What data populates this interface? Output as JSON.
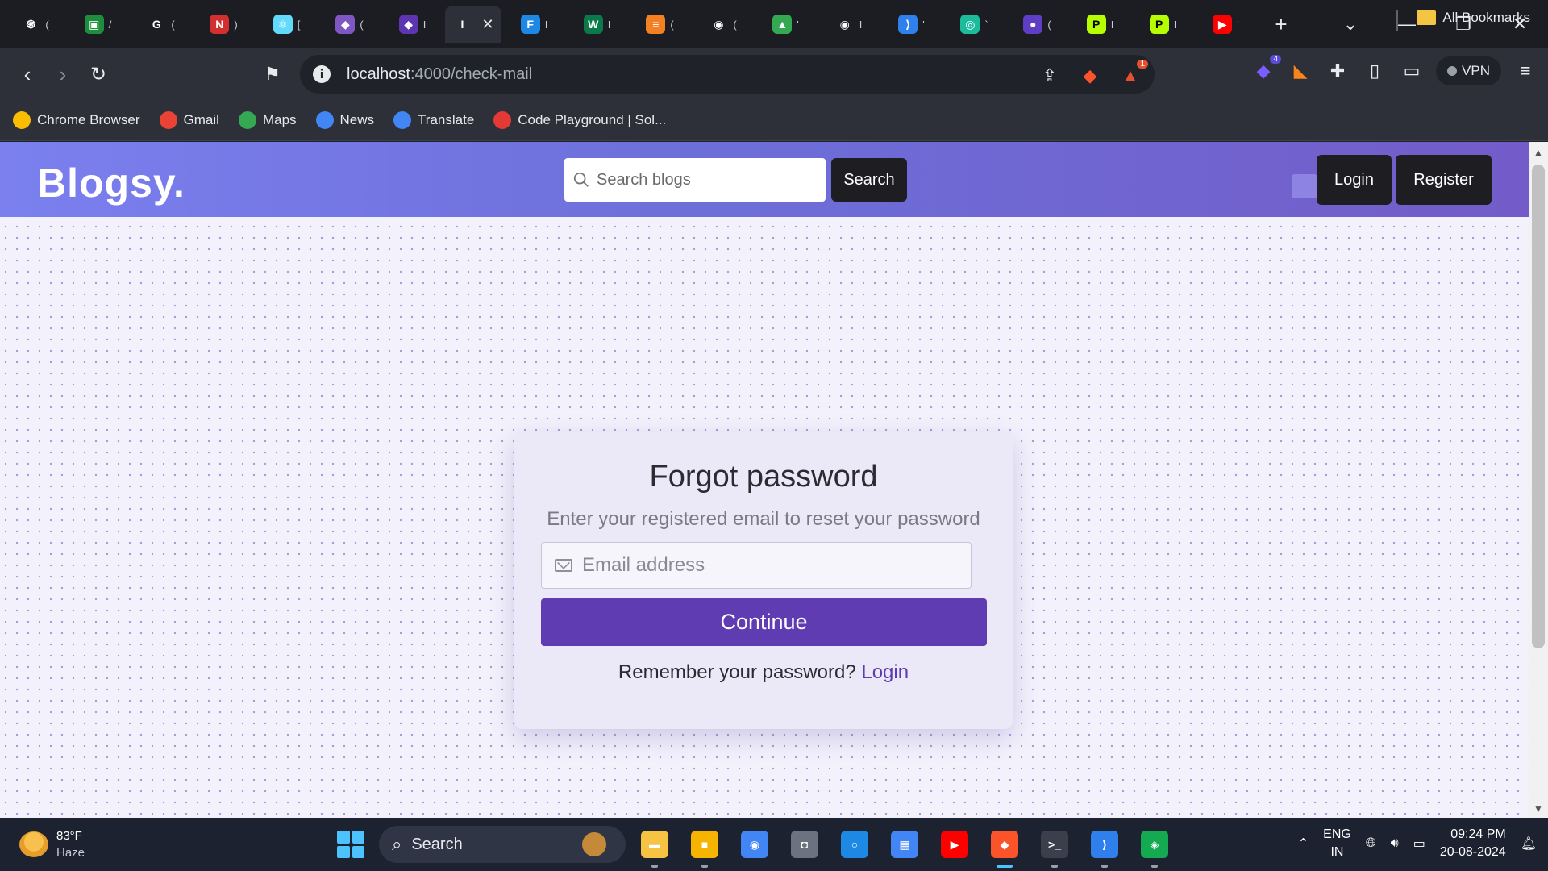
{
  "browser": {
    "tabs": [
      {
        "icon": "chatgpt-icon",
        "color": "#ffffff",
        "glyph": "֍",
        "title": "("
      },
      {
        "icon": "classroom-icon",
        "color": "#1e8e3e",
        "glyph": "▣",
        "title": "/"
      },
      {
        "icon": "google-icon",
        "color": "#ffffff",
        "glyph": "G",
        "title": "("
      },
      {
        "icon": "n-icon",
        "color": "#d32f2f",
        "glyph": "N",
        "title": ")"
      },
      {
        "icon": "react-icon",
        "color": "#61dafb",
        "glyph": "⚛",
        "title": "["
      },
      {
        "icon": "shield-icon",
        "color": "#7e57c2",
        "glyph": "◆",
        "title": "("
      },
      {
        "icon": "diamond-icon",
        "color": "#5e35b1",
        "glyph": "◆",
        "title": "I"
      },
      {
        "icon": "blank-icon",
        "color": "#2d3038",
        "glyph": "I",
        "title": ""
      },
      {
        "icon": "f-icon",
        "color": "#1e88e5",
        "glyph": "F",
        "title": "I"
      },
      {
        "icon": "w-icon",
        "color": "#0b7a4b",
        "glyph": "W",
        "title": "I"
      },
      {
        "icon": "stackoverflow-icon",
        "color": "#f48024",
        "glyph": "≡",
        "title": "("
      },
      {
        "icon": "github-icon",
        "color": "#ffffff",
        "glyph": "◉",
        "title": "("
      },
      {
        "icon": "drive-icon",
        "color": "#34a853",
        "glyph": "▲",
        "title": "'"
      },
      {
        "icon": "github-icon",
        "color": "#ffffff",
        "glyph": "◉",
        "title": "I"
      },
      {
        "icon": "vscode-icon",
        "color": "#2f80ed",
        "glyph": "⟩",
        "title": "'"
      },
      {
        "icon": "globe-icon",
        "color": "#1abc9c",
        "glyph": "◎",
        "title": "`"
      },
      {
        "icon": "meet-icon",
        "color": "#5f3dc4",
        "glyph": "●",
        "title": "("
      },
      {
        "icon": "p-icon",
        "color": "#b6ff00",
        "glyph": "P",
        "title": "I"
      },
      {
        "icon": "p-icon",
        "color": "#b6ff00",
        "glyph": "P",
        "title": "I"
      },
      {
        "icon": "youtube-icon",
        "color": "#ff0000",
        "glyph": "▶",
        "title": "'"
      }
    ],
    "active_tab_index": 7,
    "url_host": "localhost",
    "url_path": ":4000/check-mail",
    "bookmarks": [
      {
        "label": "Chrome Browser",
        "icon": "chrome-icon",
        "color": "#fbbc04"
      },
      {
        "label": "Gmail",
        "icon": "gmail-icon",
        "color": "#ea4335"
      },
      {
        "label": "Maps",
        "icon": "maps-icon",
        "color": "#34a853"
      },
      {
        "label": "News",
        "icon": "news-icon",
        "color": "#4285f4"
      },
      {
        "label": "Translate",
        "icon": "translate-icon",
        "color": "#4285f4"
      },
      {
        "label": "Code Playground | Sol...",
        "icon": "sololearn-icon",
        "color": "#e53935"
      }
    ],
    "all_bookmarks_label": "All Bookmarks",
    "vpn_label": "VPN",
    "ext_badge_count": "4",
    "brave_rewards_badge": "1"
  },
  "site": {
    "brand": "Blogsy.",
    "search_placeholder": "Search blogs",
    "search_button": "Search",
    "login_button": "Login",
    "register_button": "Register"
  },
  "card": {
    "title": "Forgot password",
    "subtitle": "Enter your registered email to reset your password",
    "email_placeholder": "Email address",
    "continue_button": "Continue",
    "remember_text": "Remember your password?",
    "login_link": "Login"
  },
  "taskbar": {
    "temperature": "83°F",
    "weather": "Haze",
    "search_label": "Search",
    "lang_top": "ENG",
    "lang_bottom": "IN",
    "time": "09:24 PM",
    "date": "20-08-2024",
    "apps": [
      {
        "icon": "file-explorer-icon",
        "color": "#f6c343",
        "glyph": "▬",
        "state": "running"
      },
      {
        "icon": "folder-icon",
        "color": "#f4b400",
        "glyph": "■",
        "state": "running"
      },
      {
        "icon": "chrome-icon",
        "color": "#4285f4",
        "glyph": "◉",
        "state": ""
      },
      {
        "icon": "camera-icon",
        "color": "#6b7280",
        "glyph": "◘",
        "state": ""
      },
      {
        "icon": "cortana-icon",
        "color": "#1e88e5",
        "glyph": "○",
        "state": ""
      },
      {
        "icon": "store-icon",
        "color": "#4285f4",
        "glyph": "▦",
        "state": ""
      },
      {
        "icon": "youtube-icon",
        "color": "#ff0000",
        "glyph": "▶",
        "state": ""
      },
      {
        "icon": "brave-icon",
        "color": "#fb542b",
        "glyph": "◆",
        "state": "active"
      },
      {
        "icon": "terminal-icon",
        "color": "#3a3f4b",
        "glyph": ">_",
        "state": "running"
      },
      {
        "icon": "vscode-icon",
        "color": "#2f80ed",
        "glyph": "⟩",
        "state": "running"
      },
      {
        "icon": "mongodb-icon",
        "color": "#13aa52",
        "glyph": "◈",
        "state": "running"
      }
    ]
  }
}
